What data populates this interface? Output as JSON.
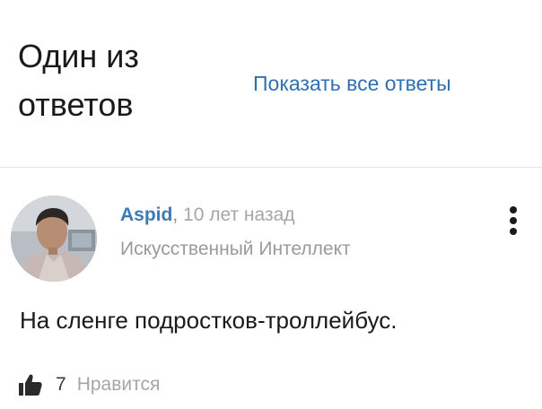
{
  "header": {
    "title": "Один из ответов",
    "show_all_link": "Показать все ответы"
  },
  "answer": {
    "author": "Aspid",
    "separator": ",",
    "time_ago": "10 лет назад",
    "role": "Искусственный Интеллект",
    "text": "На сленге подростков-троллейбус.",
    "likes": {
      "count": "7",
      "label": "Нравится"
    }
  },
  "icons": {
    "avatar": "user-photo",
    "more": "vertical-dots-icon",
    "like": "thumbs-up-icon"
  },
  "colors": {
    "link": "#2f6fb2",
    "author": "#3d79b8",
    "muted": "#a6a6a6",
    "text": "#1a1a1a"
  }
}
